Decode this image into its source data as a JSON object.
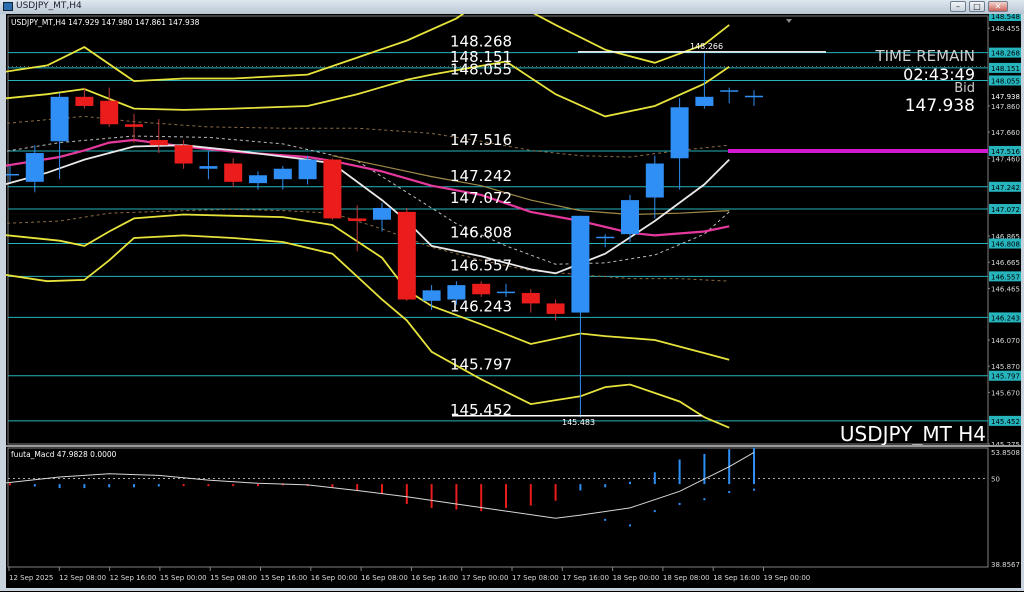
{
  "window": {
    "title": "USDJPY_MT,H4",
    "icons": [
      "app-icon",
      "minimize-icon",
      "restore-icon",
      "close-icon"
    ]
  },
  "colors": {
    "background": "#000000",
    "bull_candle": "#2f8ff5",
    "bear_candle": "#ea1c1c",
    "bollinger": "#e7e33c",
    "ma_pink": "#e5389c",
    "ma_white": "#e9e9e9",
    "level_line": "#26b4bd",
    "bid_line": "#d11ad1"
  },
  "chart_data": [
    {
      "type": "candlestick",
      "symbol_header": "USDJPY_MT,H4  147.929 147.980 147.861 147.938",
      "watermark": "USDJPY_MT H4",
      "time_remain_label": "TIME REMAIN",
      "time_remain_value": "02:43:49",
      "bid_label": "Bid",
      "bid_value": "147.938",
      "bid_price": 147.516,
      "ylim": [
        145.275,
        148.548
      ],
      "y_ticks": [
        "148.548",
        "148.455",
        "148.268",
        "148.151",
        "148.055",
        "147.938",
        "147.860",
        "147.660",
        "147.516",
        "147.460",
        "147.242",
        "147.072",
        "146.865",
        "146.808",
        "146.665",
        "146.557",
        "146.465",
        "146.243",
        "146.070",
        "145.870",
        "145.797",
        "145.670",
        "145.452",
        "145.275"
      ],
      "x_ticks": [
        "12 Sep 2025",
        "12 Sep 08:00",
        "12 Sep 16:00",
        "15 Sep 00:00",
        "15 Sep 08:00",
        "15 Sep 16:00",
        "16 Sep 00:00",
        "16 Sep 08:00",
        "16 Sep 16:00",
        "17 Sep 00:00",
        "17 Sep 08:00",
        "17 Sep 16:00",
        "18 Sep 00:00",
        "18 Sep 08:00",
        "18 Sep 16:00",
        "19 Sep 00:00"
      ],
      "level_lines": [
        148.268,
        148.151,
        148.055,
        147.516,
        147.242,
        147.072,
        146.808,
        146.557,
        146.243,
        145.797,
        145.452
      ],
      "level_labels": [
        "148.268",
        "148.151",
        "148.055",
        "147.516",
        "147.242",
        "147.072",
        "146.808",
        "146.557",
        "146.243",
        "145.797",
        "145.452"
      ],
      "high_marker": {
        "label": "148.266",
        "value": 148.266
      },
      "low_marker": {
        "label": "145.483",
        "value": 145.483
      },
      "candles": [
        {
          "o": 147.34,
          "h": 147.4,
          "l": 147.28,
          "c": 147.34
        },
        {
          "o": 147.28,
          "h": 147.56,
          "l": 147.2,
          "c": 147.5
        },
        {
          "o": 147.59,
          "h": 147.96,
          "l": 147.3,
          "c": 147.93
        },
        {
          "o": 147.93,
          "h": 148.0,
          "l": 147.84,
          "c": 147.86
        },
        {
          "o": 147.9,
          "h": 148.0,
          "l": 147.7,
          "c": 147.72
        },
        {
          "o": 147.72,
          "h": 147.8,
          "l": 147.58,
          "c": 147.7
        },
        {
          "o": 147.6,
          "h": 147.76,
          "l": 147.5,
          "c": 147.56
        },
        {
          "o": 147.56,
          "h": 147.6,
          "l": 147.38,
          "c": 147.42
        },
        {
          "o": 147.38,
          "h": 147.52,
          "l": 147.3,
          "c": 147.4
        },
        {
          "o": 147.42,
          "h": 147.46,
          "l": 147.24,
          "c": 147.28
        },
        {
          "o": 147.27,
          "h": 147.36,
          "l": 147.22,
          "c": 147.33
        },
        {
          "o": 147.3,
          "h": 147.4,
          "l": 147.22,
          "c": 147.38
        },
        {
          "o": 147.3,
          "h": 147.48,
          "l": 147.26,
          "c": 147.45
        },
        {
          "o": 147.45,
          "h": 147.46,
          "l": 146.99,
          "c": 147.0
        },
        {
          "o": 147.0,
          "h": 147.1,
          "l": 146.75,
          "c": 146.98
        },
        {
          "o": 146.99,
          "h": 147.12,
          "l": 146.9,
          "c": 147.08
        },
        {
          "o": 147.05,
          "h": 147.08,
          "l": 146.37,
          "c": 146.38
        },
        {
          "o": 146.37,
          "h": 146.49,
          "l": 146.3,
          "c": 146.45
        },
        {
          "o": 146.38,
          "h": 146.52,
          "l": 146.34,
          "c": 146.49
        },
        {
          "o": 146.5,
          "h": 146.52,
          "l": 146.4,
          "c": 146.42
        },
        {
          "o": 146.44,
          "h": 146.5,
          "l": 146.4,
          "c": 146.44
        },
        {
          "o": 146.43,
          "h": 146.46,
          "l": 146.28,
          "c": 146.35
        },
        {
          "o": 146.35,
          "h": 146.38,
          "l": 146.22,
          "c": 146.27
        },
        {
          "o": 146.28,
          "h": 147.02,
          "l": 145.48,
          "c": 147.02
        },
        {
          "o": 146.85,
          "h": 146.88,
          "l": 146.78,
          "c": 146.86
        },
        {
          "o": 146.88,
          "h": 147.18,
          "l": 146.82,
          "c": 147.14
        },
        {
          "o": 147.16,
          "h": 147.48,
          "l": 147.0,
          "c": 147.42
        },
        {
          "o": 147.46,
          "h": 147.92,
          "l": 147.22,
          "c": 147.85
        },
        {
          "o": 147.86,
          "h": 148.266,
          "l": 147.84,
          "c": 147.93
        },
        {
          "o": 147.98,
          "h": 148.0,
          "l": 147.88,
          "c": 147.98
        },
        {
          "o": 147.929,
          "h": 147.98,
          "l": 147.861,
          "c": 147.938
        }
      ],
      "indicator_lines": {
        "bb_outer_upper": [
          [
            -0.6,
            148.11
          ],
          [
            1.5,
            148.17
          ],
          [
            3,
            148.31
          ],
          [
            5,
            148.05
          ],
          [
            7,
            148.07
          ],
          [
            9,
            148.07
          ],
          [
            12,
            148.1
          ],
          [
            14,
            148.23
          ],
          [
            16,
            148.36
          ],
          [
            18,
            148.53
          ],
          [
            20,
            148.79
          ]
        ],
        "bb_outer_upper_right": [
          [
            21,
            148.58
          ],
          [
            22,
            148.48
          ],
          [
            24,
            148.29
          ],
          [
            26,
            148.19
          ],
          [
            28,
            148.33
          ],
          [
            29,
            148.48
          ]
        ],
        "bb_mid_upper": [
          [
            -0.6,
            147.91
          ],
          [
            1.5,
            147.95
          ],
          [
            3,
            147.99
          ],
          [
            5,
            147.84
          ],
          [
            7,
            147.83
          ],
          [
            9,
            147.84
          ],
          [
            12,
            147.86
          ],
          [
            14,
            147.95
          ],
          [
            16,
            148.06
          ],
          [
            17,
            148.1
          ],
          [
            20,
            148.2
          ]
        ],
        "bb_mid_upper_right": [
          [
            20,
            148.2
          ],
          [
            22,
            147.95
          ],
          [
            24,
            147.78
          ],
          [
            26,
            147.86
          ],
          [
            28,
            148.03
          ],
          [
            29,
            148.16
          ]
        ],
        "bb_mid_lower": [
          [
            -0.6,
            146.88
          ],
          [
            2,
            146.83
          ],
          [
            3,
            146.79
          ],
          [
            4,
            146.9
          ],
          [
            5,
            147.0
          ],
          [
            7,
            147.03
          ],
          [
            9,
            147.02
          ],
          [
            11,
            147.01
          ],
          [
            13,
            146.95
          ],
          [
            15,
            146.7
          ],
          [
            16,
            146.45
          ],
          [
            17,
            146.33
          ],
          [
            19,
            146.19
          ],
          [
            21,
            146.04
          ],
          [
            23,
            146.12
          ],
          [
            24,
            146.1
          ],
          [
            26,
            146.07
          ],
          [
            28,
            145.97
          ],
          [
            29,
            145.92
          ]
        ],
        "bb_outer_lower": [
          [
            -0.6,
            146.58
          ],
          [
            1.5,
            146.52
          ],
          [
            3,
            146.53
          ],
          [
            4,
            146.68
          ],
          [
            5,
            146.85
          ],
          [
            7,
            146.87
          ],
          [
            9,
            146.85
          ],
          [
            11,
            146.82
          ],
          [
            13,
            146.73
          ],
          [
            15,
            146.38
          ],
          [
            16,
            146.22
          ],
          [
            17,
            145.98
          ],
          [
            19,
            145.77
          ],
          [
            21,
            145.58
          ],
          [
            23,
            145.64
          ],
          [
            24,
            145.71
          ],
          [
            25,
            145.73
          ],
          [
            27,
            145.6
          ],
          [
            28,
            145.48
          ],
          [
            29,
            145.4
          ]
        ],
        "ma_pink": [
          [
            -0.6,
            147.39
          ],
          [
            2,
            147.47
          ],
          [
            3,
            147.52
          ],
          [
            4,
            147.58
          ],
          [
            5,
            147.6
          ],
          [
            7,
            147.55
          ],
          [
            9,
            147.51
          ],
          [
            12,
            147.47
          ],
          [
            13,
            147.44
          ],
          [
            15,
            147.36
          ],
          [
            17,
            147.25
          ],
          [
            19,
            147.18
          ],
          [
            21,
            147.05
          ],
          [
            23,
            146.98
          ],
          [
            25,
            146.89
          ],
          [
            26,
            146.87
          ],
          [
            28,
            146.9
          ],
          [
            29,
            146.94
          ]
        ],
        "ma_white": [
          [
            -0.6,
            147.24
          ],
          [
            1.5,
            147.35
          ],
          [
            3,
            147.45
          ],
          [
            5,
            147.55
          ],
          [
            7,
            147.56
          ],
          [
            9,
            147.52
          ],
          [
            12,
            147.45
          ],
          [
            13,
            147.42
          ],
          [
            15,
            147.14
          ],
          [
            16,
            146.98
          ],
          [
            17,
            146.79
          ],
          [
            19,
            146.71
          ],
          [
            21,
            146.61
          ],
          [
            22,
            146.58
          ],
          [
            24,
            146.73
          ],
          [
            26,
            146.98
          ],
          [
            28,
            147.26
          ],
          [
            29,
            147.45
          ]
        ],
        "dashed_brown_upper": [
          [
            -0.6,
            147.72
          ],
          [
            3,
            147.78
          ],
          [
            5,
            147.74
          ],
          [
            8,
            147.7
          ],
          [
            11,
            147.69
          ],
          [
            14,
            147.69
          ],
          [
            17,
            147.65
          ],
          [
            19,
            147.59
          ],
          [
            21,
            147.52
          ],
          [
            23,
            147.48
          ],
          [
            25,
            147.47
          ],
          [
            27,
            147.52
          ],
          [
            29,
            147.56
          ]
        ],
        "dashed_brown_lower": [
          [
            -0.6,
            146.96
          ],
          [
            2,
            146.98
          ],
          [
            4,
            147.04
          ],
          [
            7,
            147.06
          ],
          [
            9,
            147.07
          ],
          [
            11,
            147.06
          ],
          [
            13,
            147.04
          ],
          [
            15,
            146.92
          ],
          [
            17,
            146.78
          ],
          [
            19,
            146.68
          ],
          [
            21,
            146.6
          ],
          [
            23,
            146.57
          ],
          [
            25,
            146.54
          ],
          [
            27,
            146.54
          ],
          [
            29,
            146.52
          ]
        ],
        "dashed_white": [
          [
            -0.6,
            147.5
          ],
          [
            2,
            147.58
          ],
          [
            5,
            147.63
          ],
          [
            8,
            147.62
          ],
          [
            11,
            147.57
          ],
          [
            14,
            147.44
          ],
          [
            16,
            147.2
          ],
          [
            18,
            146.96
          ],
          [
            20,
            146.79
          ],
          [
            22,
            146.65
          ],
          [
            24,
            146.66
          ],
          [
            26,
            146.72
          ],
          [
            28,
            146.88
          ],
          [
            29,
            147.05
          ]
        ],
        "olive_line": [
          [
            13,
            147.48
          ],
          [
            15,
            147.4
          ],
          [
            17,
            147.32
          ],
          [
            19,
            147.25
          ],
          [
            21,
            147.14
          ],
          [
            23,
            147.06
          ],
          [
            25,
            147.03
          ],
          [
            27,
            147.04
          ],
          [
            29,
            147.06
          ]
        ]
      }
    },
    {
      "type": "histogram",
      "label": "fuuta_Macd 47.9828  0.0000",
      "ylim": [
        38.8567,
        53.8508
      ],
      "y_ticks": [
        "53.8508",
        "50",
        "38.8567"
      ],
      "zero_level": 50,
      "bars": [
        {
          "v": 49.4,
          "pos": false
        },
        {
          "v": 49.0,
          "pos": true
        },
        {
          "v": 48.8,
          "pos": true
        },
        {
          "v": 48.8,
          "pos": true
        },
        {
          "v": 48.9,
          "pos": true
        },
        {
          "v": 48.9,
          "pos": true
        },
        {
          "v": 49.0,
          "pos": true
        },
        {
          "v": 49.2,
          "pos": false
        },
        {
          "v": 49.3,
          "pos": false
        },
        {
          "v": 49.2,
          "pos": false
        },
        {
          "v": 49.3,
          "pos": false
        },
        {
          "v": 49.4,
          "pos": false
        },
        {
          "v": 49.3,
          "pos": false
        },
        {
          "v": 48.9,
          "pos": false
        },
        {
          "v": 48.5,
          "pos": false
        },
        {
          "v": 48.1,
          "pos": false
        },
        {
          "v": 46.8,
          "pos": false
        },
        {
          "v": 46.3,
          "pos": false
        },
        {
          "v": 46.1,
          "pos": false
        },
        {
          "v": 45.9,
          "pos": false
        },
        {
          "v": 46.3,
          "pos": false
        },
        {
          "v": 46.6,
          "pos": false
        },
        {
          "v": 47.2,
          "pos": false
        },
        {
          "v": 48.5,
          "pos": true
        },
        {
          "v": 48.9,
          "pos": true
        },
        {
          "v": 49.6,
          "pos": true
        },
        {
          "v": 50.8,
          "pos": true
        },
        {
          "v": 52.4,
          "pos": true
        },
        {
          "v": 53.1,
          "pos": true
        },
        {
          "v": 53.7,
          "pos": true
        },
        {
          "v": 53.9,
          "pos": true
        }
      ],
      "signal_line": [
        [
          -0.6,
          49.3
        ],
        [
          2,
          50.2
        ],
        [
          4,
          50.6
        ],
        [
          6,
          50.4
        ],
        [
          8,
          49.8
        ],
        [
          10,
          49.4
        ],
        [
          12,
          49.2
        ],
        [
          14,
          48.5
        ],
        [
          16,
          47.7
        ],
        [
          18,
          46.8
        ],
        [
          20,
          45.9
        ],
        [
          22,
          45.0
        ],
        [
          23,
          45.4
        ],
        [
          25,
          46.3
        ],
        [
          27,
          48.4
        ],
        [
          29,
          51.5
        ],
        [
          30,
          53.3
        ]
      ],
      "signal_dots": [
        [
          24,
          44.8
        ],
        [
          25,
          44.1
        ],
        [
          26,
          45.9
        ],
        [
          27,
          46.8
        ],
        [
          28,
          47.4
        ],
        [
          29,
          48.3
        ],
        [
          30,
          48.6
        ]
      ]
    }
  ]
}
